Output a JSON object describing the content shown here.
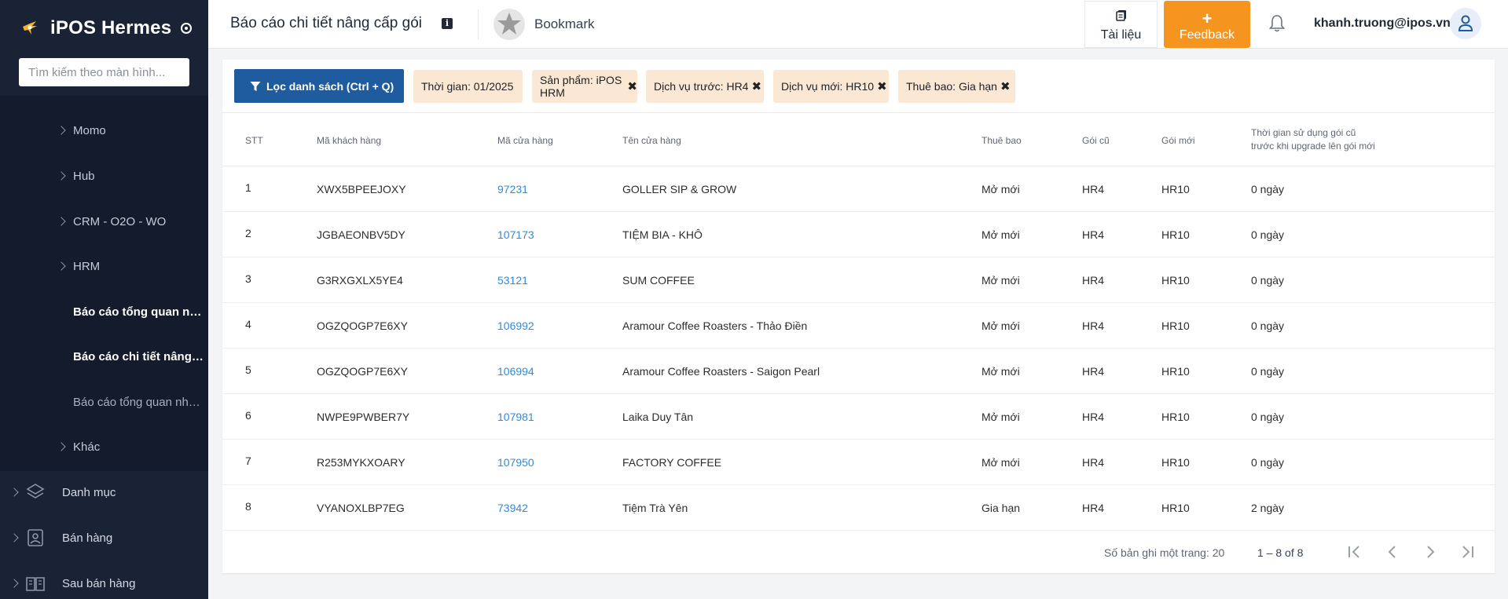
{
  "sidebar": {
    "brand": "iPOS Hermes",
    "search_placeholder": "Tìm kiếm theo màn hình...",
    "sub_items": [
      {
        "label": "Momo",
        "type": "group"
      },
      {
        "label": "Hub",
        "type": "group"
      },
      {
        "label": "CRM - O2O - WO",
        "type": "group"
      },
      {
        "label": "HRM",
        "type": "group"
      },
      {
        "label": "Báo cáo tổng quan nâng cấp gói",
        "type": "link",
        "state": "normal-bold"
      },
      {
        "label": "Báo cáo chi tiết nâng cấp gói",
        "type": "link",
        "state": "active"
      },
      {
        "label": "Báo cáo tổng quan nhân viên",
        "type": "link",
        "state": "dim"
      },
      {
        "label": "Khác",
        "type": "group"
      }
    ],
    "main_items": [
      {
        "label": "Danh mục",
        "icon": "layers-icon"
      },
      {
        "label": "Bán hàng",
        "icon": "cashier-icon"
      },
      {
        "label": "Sau bán hàng",
        "icon": "book-icon"
      }
    ]
  },
  "header": {
    "title": "Báo cáo chi tiết nâng cấp gói",
    "bookmark_label": "Bookmark",
    "docs_label": "Tài liệu",
    "feedback_plus": "+",
    "feedback_label": "Feedback",
    "user_email": "khanh.truong@ipos.vn"
  },
  "filters": {
    "button_label": "Lọc danh sách (Ctrl + Q)",
    "chips": [
      {
        "label": "Thời gian: 01/2025",
        "removable": false
      },
      {
        "label": "Sản phẩm: iPOS HRM",
        "removable": true
      },
      {
        "label": "Dịch vụ trước: HR4",
        "removable": true
      },
      {
        "label": "Dịch vụ mới: HR10",
        "removable": true
      },
      {
        "label": "Thuê bao: Gia hạn",
        "removable": true
      }
    ],
    "remove_glyph": "✖"
  },
  "table": {
    "columns": {
      "stt": "STT",
      "customer_code": "Mã khách hàng",
      "store_code": "Mã cửa hàng",
      "store_name": "Tên cửa hàng",
      "subscription": "Thuê bao",
      "old_plan": "Gói cũ",
      "new_plan": "Gói mới",
      "usage_line1": "Thời gian sử dụng gói cũ",
      "usage_line2": "trước khi upgrade lên gói mới"
    },
    "rows": [
      {
        "stt": "1",
        "customer_code": "XWX5BPEEJOXY",
        "store_code": "97231",
        "store_name": "GOLLER SIP & GROW",
        "subscription": "Mở mới",
        "old_plan": "HR4",
        "new_plan": "HR10",
        "usage": "0 ngày"
      },
      {
        "stt": "2",
        "customer_code": "JGBAEONBV5DY",
        "store_code": "107173",
        "store_name": "TIỆM BIA - KHÔ",
        "subscription": "Mở mới",
        "old_plan": "HR4",
        "new_plan": "HR10",
        "usage": "0 ngày"
      },
      {
        "stt": "3",
        "customer_code": "G3RXGXLX5YE4",
        "store_code": "53121",
        "store_name": "SUM COFFEE",
        "subscription": "Mở mới",
        "old_plan": "HR4",
        "new_plan": "HR10",
        "usage": "0 ngày"
      },
      {
        "stt": "4",
        "customer_code": "OGZQOGP7E6XY",
        "store_code": "106992",
        "store_name": "Aramour Coffee Roasters - Thảo Điền",
        "subscription": "Mở mới",
        "old_plan": "HR4",
        "new_plan": "HR10",
        "usage": "0 ngày"
      },
      {
        "stt": "5",
        "customer_code": "OGZQOGP7E6XY",
        "store_code": "106994",
        "store_name": "Aramour Coffee Roasters - Saigon Pearl",
        "subscription": "Mở mới",
        "old_plan": "HR4",
        "new_plan": "HR10",
        "usage": "0 ngày"
      },
      {
        "stt": "6",
        "customer_code": "NWPE9PWBER7Y",
        "store_code": "107981",
        "store_name": "Laika Duy Tân",
        "subscription": "Mở mới",
        "old_plan": "HR4",
        "new_plan": "HR10",
        "usage": "0 ngày"
      },
      {
        "stt": "7",
        "customer_code": "R253MYKXOARY",
        "store_code": "107950",
        "store_name": "FACTORY COFFEE",
        "subscription": "Mở mới",
        "old_plan": "HR4",
        "new_plan": "HR10",
        "usage": "0 ngày"
      },
      {
        "stt": "8",
        "customer_code": "VYANOXLBP7EG",
        "store_code": "73942",
        "store_name": "Tiệm Trà Yên",
        "subscription": "Gia hạn",
        "old_plan": "HR4",
        "new_plan": "HR10",
        "usage": "2 ngày"
      }
    ]
  },
  "pagination": {
    "page_size_label": "Số bản ghi một trang: 20",
    "range_label": "1 – 8 of 8"
  },
  "colors": {
    "sidebar_bg": "#1a2236",
    "primary_button": "#1e5b9f",
    "feedback": "#f5951f",
    "chip_bg": "#fbe8d4",
    "link": "#2f8ae0"
  }
}
